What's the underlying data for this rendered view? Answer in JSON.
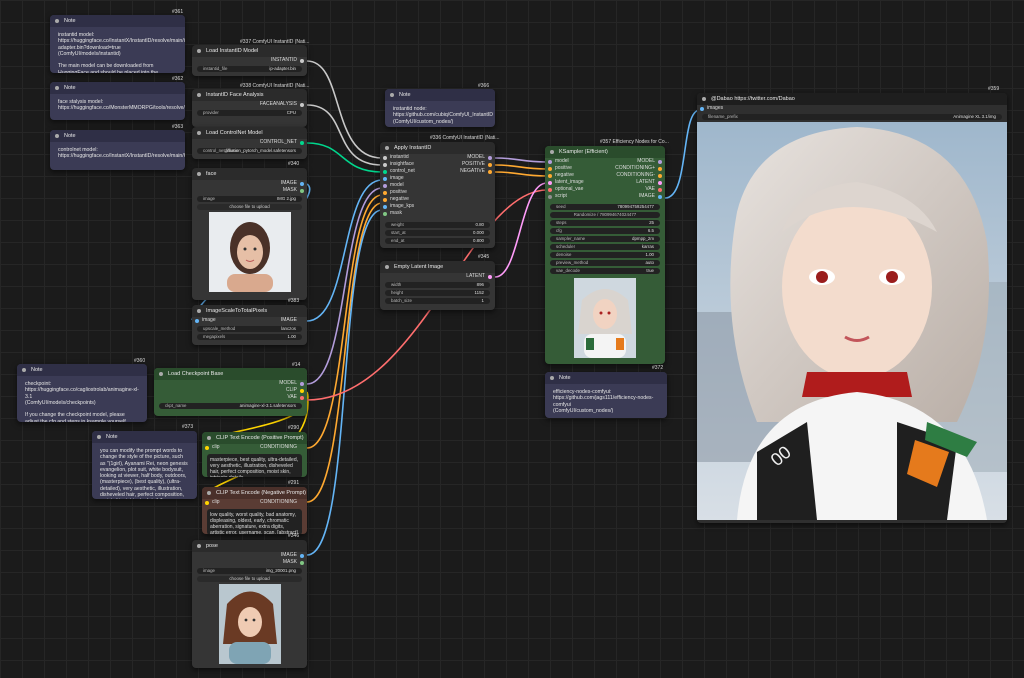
{
  "colors": {
    "image": "#64b5f6",
    "model": "#b39ddb",
    "clip": "#ffd500",
    "vae": "#ff6e6e",
    "conditioning": "#ffa931",
    "latent": "#ff9cf9",
    "control_net": "#00d78d",
    "mask": "#81c784",
    "faceanalysis": "#c9c9c9",
    "instantid": "#c9c9c9",
    "grey": "#8f8f8f"
  },
  "notes": {
    "n361": {
      "id": "#361",
      "title": "Note",
      "text": "instantid model:\nhttps://huggingface.co/InstantX/InstantID/resolve/main/ip-adapter.bin?download=true\n(ComfyUI/models/instantid)\n\nThe main model can be downloaded from HuggingFace and should be placed into the ComfyUI/models/instantid"
    },
    "n362": {
      "id": "#362",
      "title": "Note",
      "text": "face stalysis model:\nhttps://huggingface.co/MonsterMMORPG/tools/resolve/main/antelopev2.zip"
    },
    "n363": {
      "id": "#363",
      "title": "Note",
      "text": "controlnet model:\nhttps://huggingface.co/InstantX/InstantID/resolve/main/ControlNetModel/diffusion_pytorch_model.safetensors?"
    },
    "n366": {
      "id": "#366",
      "title": "Note",
      "text": "instantid node:\nhttps://github.com/cubiq/ComfyUI_InstantID\n(ComfyUI/custom_nodes/)"
    },
    "n360": {
      "id": "#360",
      "title": "Note",
      "text": "checkpoint:\nhttps://huggingface.co/cagliostrolab/animagine-xl-3.1\n(ComfyUI/models/checkpoints)\n\nIf you change the checkpoint model, please adjust the cfg and steps in ksample yourself"
    },
    "n373": {
      "id": "#373",
      "title": "Note",
      "text": "you can modify the prompt words to change the style of the picture, such as \"(1girl), Ayanami Rei, neon genesis evangelion, plot suit, white bodysuit, looking at viewer, half body, outdoors, (masterpiece), (best quality), (ultra-detailed), very aesthetic, illustration, disheveled hair, perfect composition, moist skin, intricate details\""
    },
    "n372": {
      "id": "#372",
      "title": "Note",
      "text": "efficiency-nodes-comfyui:\nhttps://github.com/jags111/efficiency-nodes-comfyui\n(ComfyUI/custom_nodes/)"
    }
  },
  "nodes": {
    "loadInstantid": {
      "id": "#337 ComfyUI InstantID (Nati...",
      "title": "Load InstantID Model",
      "out": "INSTANTID",
      "w_label": "instantid_file",
      "w_val": "ip-adapter.bin"
    },
    "faceAnalysis": {
      "id": "#338 ComfyUI InstantID (Nati...",
      "title": "InstantID Face Analysis",
      "out": "FACEANALYSIS",
      "w_label": "provider",
      "w_val": "CPU"
    },
    "controlnet": {
      "id": "#339",
      "title": "Load ControlNet Model",
      "out": "CONTROL_NET",
      "w_label": "control_net_name",
      "w_val": "diffusion_pytorch_model.safetensors"
    },
    "face": {
      "id": "#340",
      "title": "face",
      "out1": "IMAGE",
      "out2": "MASK",
      "w_label": "image",
      "w_val": "IMG 2.jpg",
      "btn": "choose file to upload"
    },
    "scale": {
      "id": "#383",
      "title": "ImageScaleToTotalPixels",
      "in": "image",
      "out": "IMAGE",
      "w1_label": "upscale_method",
      "w1_val": "lanczos",
      "w2_label": "megapixels",
      "w2_val": "1.00"
    },
    "checkpoint": {
      "id": "#14",
      "title": "Load Checkpoint Base",
      "out1": "MODEL",
      "out2": "CLIP",
      "out3": "VAE",
      "w_label": "ckpt_name",
      "w_val": "animagine-xl-3.1.safetensors"
    },
    "clipPos": {
      "id": "#290",
      "title": "CLIP Text Encode (Positive Prompt)",
      "in": "clip",
      "out": "CONDITIONING",
      "text": "masterpiece, best quality, ultra-detailed, very aesthetic, illustration, disheveled hair, perfect composition, moist skin, intricate details"
    },
    "clipNeg": {
      "id": "#291",
      "title": "CLIP Text Encode (Negative Prompt)",
      "in": "clip",
      "out": "CONDITIONING",
      "text": "low quality, worst quality, bad anatomy, displeasing, oldest, early, chromatic aberration, signature, extra digits, artistic error, username, scan, [abstract]"
    },
    "pose": {
      "id": "#346",
      "title": "pose",
      "out1": "IMAGE",
      "out2": "MASK",
      "w_label": "image",
      "w_val": "img_20001.png",
      "btn": "choose file to upload"
    },
    "apply": {
      "id": "#336 ComfyUI InstantID (Nati...",
      "title": "Apply InstantID",
      "ins": [
        "instantid",
        "insightface",
        "control_net",
        "image",
        "model",
        "positive",
        "negative",
        "image_kps",
        "mask"
      ],
      "outs": [
        "MODEL",
        "POSITIVE",
        "NEGATIVE"
      ],
      "widgets": [
        [
          "weight",
          "0.80"
        ],
        [
          "start_at",
          "0.000"
        ],
        [
          "end_at",
          "0.800"
        ]
      ]
    },
    "latent": {
      "id": "#345",
      "title": "Empty Latent Image",
      "out": "LATENT",
      "widgets": [
        [
          "width",
          "896"
        ],
        [
          "height",
          "1152"
        ],
        [
          "batch_size",
          "1"
        ]
      ]
    },
    "ksampler": {
      "id": "#357 Efficiency Nodes for Co...",
      "title": "KSampler (Efficient)",
      "ins": [
        "model",
        "positive",
        "negative",
        "latent_image",
        "optional_vae",
        "script"
      ],
      "outs": [
        "MODEL",
        "CONDITIONING+",
        "CONDITIONING-",
        "LATENT",
        "VAE",
        "IMAGE"
      ],
      "seed_label": "seed",
      "seed_val": "780994759254477",
      "control": "Randomize",
      "control_val": "780994674024477",
      "widgets": [
        [
          "steps",
          "25"
        ],
        [
          "cfg",
          "6.5"
        ],
        [
          "sampler_name",
          "dpmpp_2m"
        ],
        [
          "scheduler",
          "karras"
        ],
        [
          "denoise",
          "1.00"
        ],
        [
          "preview_method",
          "auto"
        ],
        [
          "vae_decode",
          "true"
        ]
      ]
    },
    "save": {
      "id": "#359",
      "title": "@Dabao https://twitter.com/Dabao",
      "in": "images",
      "w_label": "filename_prefix",
      "w_val": "Animagine XL 3.1/img"
    }
  }
}
